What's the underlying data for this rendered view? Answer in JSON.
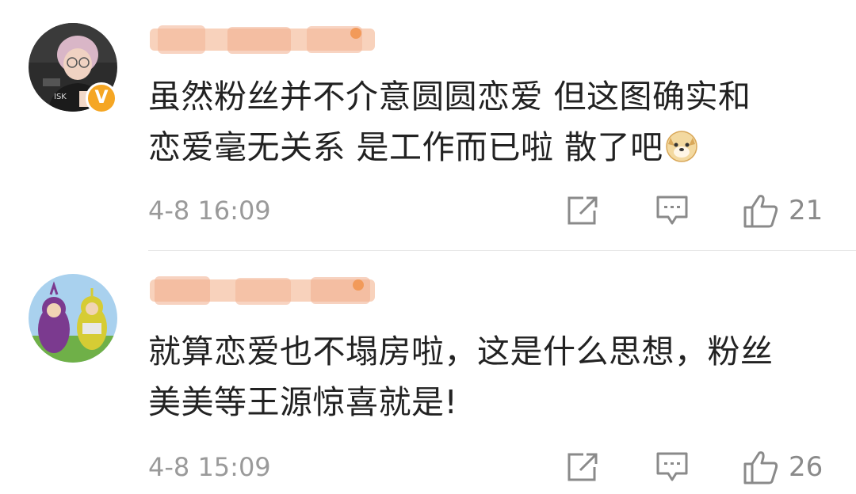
{
  "comments": [
    {
      "lines": [
        "虽然粉丝并不介意圆圆恋爱 但这图确实和",
        "恋爱毫无关系 是工作而已啦 散了吧"
      ],
      "time": "4-8 16:09",
      "likes": "21",
      "verified": true,
      "avatar": "user-photo-avatar",
      "trailing_emoji": "doge-emoji"
    },
    {
      "lines": [
        "就算恋爱也不塌房啦，这是什么思想，粉丝",
        "美美等王源惊喜就是!"
      ],
      "time": "4-8 15:09",
      "likes": "26",
      "verified": false,
      "avatar": "teletubbies-avatar"
    }
  ],
  "colors": {
    "text": "#222222",
    "meta": "#9a9a9a",
    "icon": "#8a8a8a",
    "badge": "#f5a623",
    "divider": "#e6e6e6",
    "redaction": "#f6c3a6"
  }
}
